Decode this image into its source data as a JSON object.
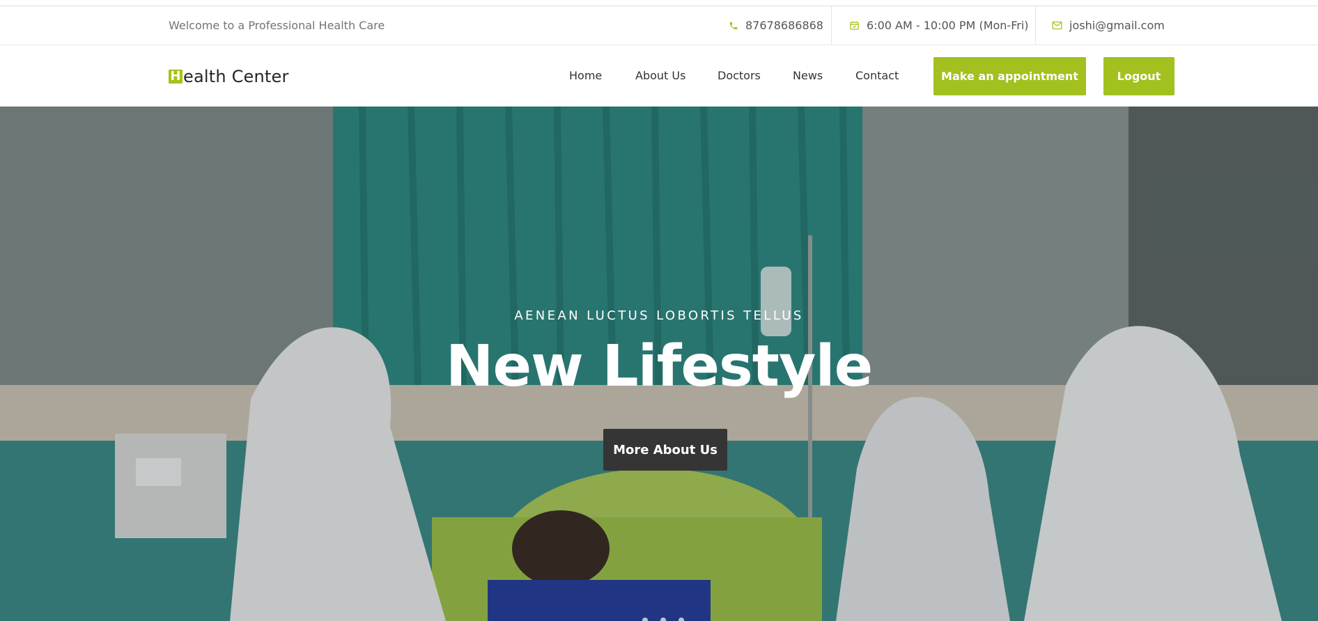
{
  "topbar": {
    "welcome": "Welcome to a Professional Health Care",
    "phone": "87678686868",
    "hours": "6:00 AM - 10:00 PM (Mon-Fri)",
    "email": "joshi@gmail.com"
  },
  "logo": {
    "letter": "H",
    "rest": "ealth Center"
  },
  "nav": {
    "items": [
      "Home",
      "About Us",
      "Doctors",
      "News",
      "Contact"
    ],
    "appointment": "Make an appointment",
    "logout": "Logout"
  },
  "hero": {
    "subtitle": "AENEAN LUCTUS LOBORTIS TELLUS",
    "title": "New Lifestyle",
    "button": "More About Us"
  },
  "colors": {
    "accent": "#a2c11f",
    "dark_button": "#353535"
  },
  "icons": [
    "phone-icon",
    "calendar-icon",
    "envelope-icon"
  ]
}
